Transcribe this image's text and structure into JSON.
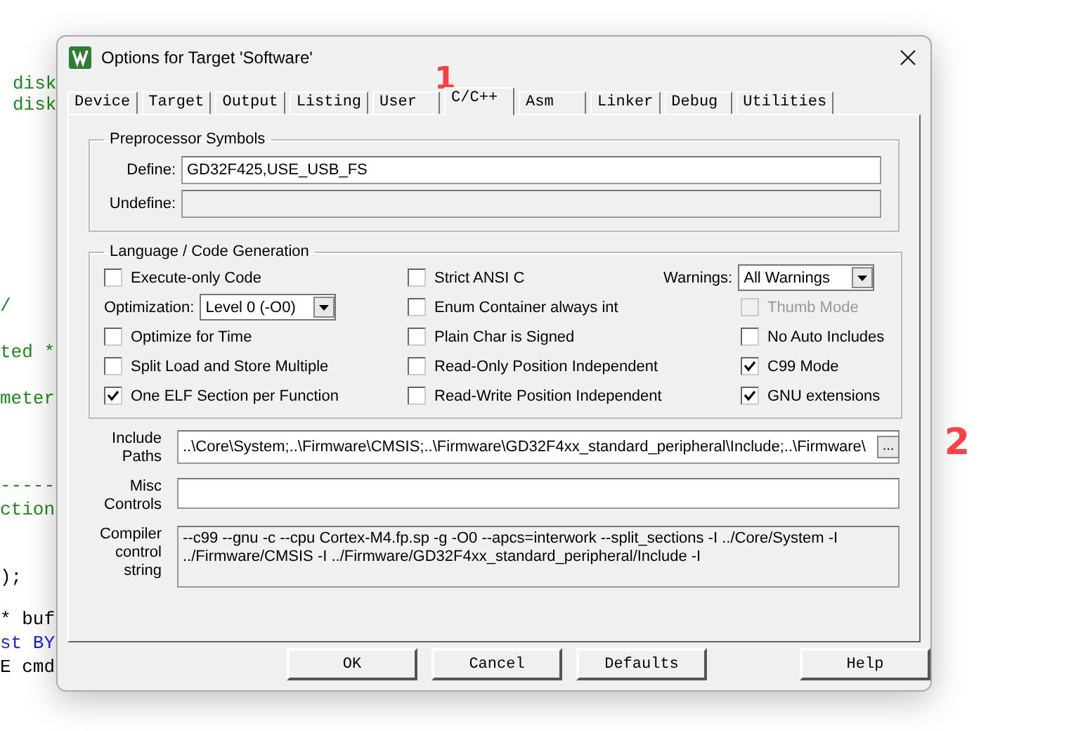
{
  "editor": {
    "lines": [
      {
        "text": "disk",
        "kind": "comment"
      },
      {
        "text": "disk",
        "kind": "comment"
      },
      {
        "text": "/",
        "kind": "comment"
      },
      {
        "text": "ted *",
        "kind": "comment"
      },
      {
        "text": "meter",
        "kind": "comment"
      },
      {
        "text": "-----",
        "kind": "comment"
      },
      {
        "text": "ction",
        "kind": "comment"
      },
      {
        "text": ");",
        "kind": "code"
      },
      {
        "text": "* buf",
        "kind": "code"
      },
      {
        "text": "st BY",
        "kind": "keyword"
      },
      {
        "text": "E cmd",
        "kind": "code"
      }
    ]
  },
  "window": {
    "title": "Options for Target 'Software'"
  },
  "tabs": [
    {
      "label": "Device",
      "selected": false
    },
    {
      "label": "Target",
      "selected": false
    },
    {
      "label": "Output",
      "selected": false
    },
    {
      "label": "Listing",
      "selected": false
    },
    {
      "label": "User",
      "selected": false
    },
    {
      "label": "C/C++",
      "selected": true
    },
    {
      "label": "Asm",
      "selected": false
    },
    {
      "label": "Linker",
      "selected": false
    },
    {
      "label": "Debug",
      "selected": false
    },
    {
      "label": "Utilities",
      "selected": false
    }
  ],
  "preprocessor": {
    "title": "Preprocessor Symbols",
    "define": {
      "label": "Define:",
      "value": "GD32F425,USE_USB_FS",
      "disabled": false
    },
    "undefine": {
      "label": "Undefine:",
      "disabled": true
    }
  },
  "language": {
    "title": "Language / Code Generation",
    "columns": [
      [
        {
          "kind": "checkbox",
          "label": "Execute-only Code",
          "checked": false,
          "disabled": false
        },
        {
          "kind": "select",
          "label": "Optimization:",
          "value": "Level 0 (-O0)"
        },
        {
          "kind": "checkbox",
          "label": "Optimize for Time",
          "checked": false,
          "disabled": false
        },
        {
          "kind": "checkbox",
          "label": "Split Load and Store Multiple",
          "checked": false,
          "disabled": false
        },
        {
          "kind": "checkbox",
          "label": "One ELF Section per Function",
          "checked": true,
          "disabled": false
        }
      ],
      [
        {
          "kind": "checkbox",
          "label": "Strict ANSI C",
          "checked": false,
          "disabled": false
        },
        {
          "kind": "checkbox",
          "label": "Enum Container always int",
          "checked": false,
          "disabled": false
        },
        {
          "kind": "checkbox",
          "label": "Plain Char is Signed",
          "checked": false,
          "disabled": false
        },
        {
          "kind": "checkbox",
          "label": "Read-Only Position Independent",
          "checked": false,
          "disabled": false
        },
        {
          "kind": "checkbox",
          "label": "Read-Write Position Independent",
          "checked": false,
          "disabled": false
        }
      ],
      [
        {
          "kind": "select",
          "label": "Warnings:",
          "value": "All Warnings"
        },
        {
          "kind": "checkbox",
          "label": "Thumb Mode",
          "checked": false,
          "disabled": true
        },
        {
          "kind": "checkbox",
          "label": "No Auto Includes",
          "checked": false,
          "disabled": false
        },
        {
          "kind": "checkbox",
          "label": "C99 Mode",
          "checked": true,
          "disabled": false
        },
        {
          "kind": "checkbox",
          "label": "GNU extensions",
          "checked": true,
          "disabled": false
        }
      ]
    ]
  },
  "include_paths": {
    "label": "Include Paths",
    "value": "..\\Core\\System;..\\Firmware\\CMSIS;..\\Firmware\\GD32F4xx_standard_peripheral\\Include;..\\Firmware\\",
    "browse": "..."
  },
  "misc_controls": {
    "label": "Misc Controls"
  },
  "compiler_string": {
    "label": "Compiler control string",
    "value": "--c99 --gnu -c --cpu Cortex-M4.fp.sp -g -O0 --apcs=interwork --split_sections -I ../Core/System -I ../Firmware/CMSIS -I ../Firmware/GD32F4xx_standard_peripheral/Include -I"
  },
  "buttons": [
    "OK",
    "Cancel",
    "Defaults",
    "Help"
  ],
  "annotations": [
    {
      "text": "1"
    },
    {
      "text": "2"
    }
  ]
}
